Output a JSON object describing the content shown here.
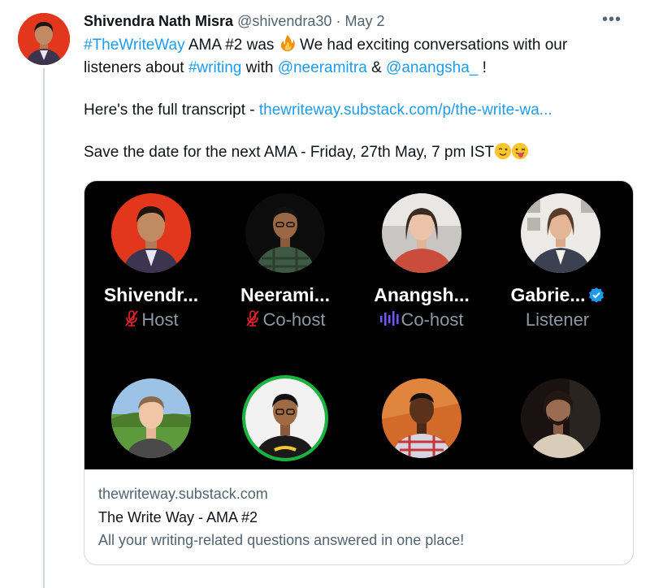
{
  "tweet": {
    "author_name": "Shivendra Nath Misra",
    "handle": "@shivendra30",
    "separator": "·",
    "date": "May 2",
    "more_label": "•••",
    "line1": {
      "hashtag1": "#TheWriteWay",
      "t1": " AMA #2 was ",
      "t2": " We had exciting conversations with our listeners about ",
      "hashtag2": "#writing",
      "t3": " with ",
      "mention1": "@neeramitra",
      "t4": " & ",
      "mention2": "@anangsha_",
      "t5": "  !"
    },
    "line2": {
      "t1": "Here's the full transcript  - ",
      "url": "thewriteway.substack.com/p/the-write-wa..."
    },
    "line3": {
      "t1": "Save the date for the next AMA - Friday, 27th May, 7 pm IST"
    }
  },
  "card": {
    "participants": [
      {
        "name": "Shivendr...",
        "role": "Host",
        "role_icon": "mic-off-icon"
      },
      {
        "name": "Neerami...",
        "role": "Co-host",
        "role_icon": "mic-off-icon"
      },
      {
        "name": "Anangsh...",
        "role": "Co-host",
        "role_icon": "speaking-icon"
      },
      {
        "name": "Gabrie...",
        "role": "Listener",
        "role_icon": "verified-icon"
      }
    ],
    "domain": "thewriteway.substack.com",
    "title": "The Write Way - AMA #2",
    "description": "All your writing-related questions answered in one place!"
  },
  "colors": {
    "link": "#1d9bf0",
    "muted": "#536471",
    "mic_off": "#f4212e",
    "speaking": "#7856ff",
    "card_bg": "#000000"
  }
}
